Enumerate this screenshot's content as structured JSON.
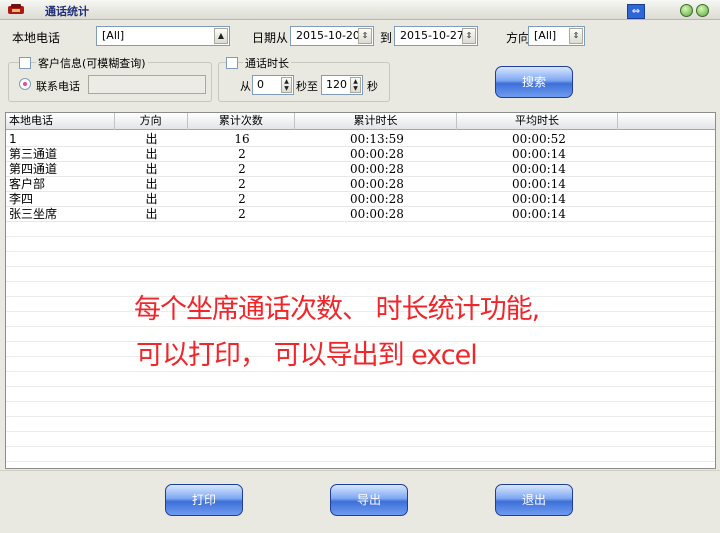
{
  "window": {
    "title": "通话统计",
    "expand_glyph": "⇔"
  },
  "filters": {
    "local_phone_label": "本地电话",
    "local_phone_value": "[All]",
    "date_from_label": "日期从",
    "date_from_value": "2015-10-20",
    "date_to_label": "到",
    "date_to_value": "2015-10-27",
    "direction_label": "方向",
    "direction_value": "[All]"
  },
  "customer_group": {
    "title": "客户信息(可模糊查询)",
    "contact_label": "联系电话",
    "contact_value": ""
  },
  "duration_group": {
    "title": "通话时长",
    "from_label": "从",
    "from_value": "0",
    "seconds_to_label": "秒至",
    "to_value": "120",
    "seconds_label": "秒"
  },
  "search_button": "搜索",
  "table": {
    "columns": [
      "本地电话",
      "方向",
      "累计次数",
      "累计时长",
      "平均时长"
    ],
    "rows": [
      {
        "phone": "1",
        "direction": "出",
        "count": "16",
        "total": "00:13:59",
        "avg": "00:00:52"
      },
      {
        "phone": "第三通道",
        "direction": "出",
        "count": "2",
        "total": "00:00:28",
        "avg": "00:00:14"
      },
      {
        "phone": "第四通道",
        "direction": "出",
        "count": "2",
        "total": "00:00:28",
        "avg": "00:00:14"
      },
      {
        "phone": "客户部",
        "direction": "出",
        "count": "2",
        "total": "00:00:28",
        "avg": "00:00:14"
      },
      {
        "phone": "李四",
        "direction": "出",
        "count": "2",
        "total": "00:00:28",
        "avg": "00:00:14"
      },
      {
        "phone": "张三坐席",
        "direction": "出",
        "count": "2",
        "total": "00:00:28",
        "avg": "00:00:14"
      }
    ]
  },
  "annotation": {
    "line1": "每个坐席通话次数、 时长统计功能,",
    "line2": "可以打印， 可以导出到 excel",
    "color": "#f0262b"
  },
  "buttons": {
    "print": "打印",
    "export": "导出",
    "exit": "退出"
  }
}
